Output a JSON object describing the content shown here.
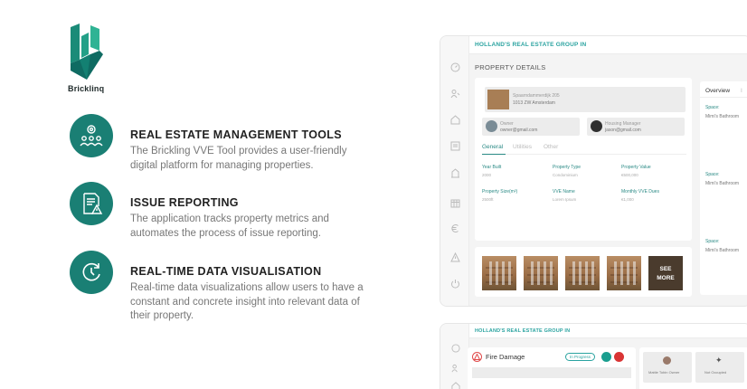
{
  "brand": {
    "name": "Bricklinq",
    "color": "#1a7f74"
  },
  "features": [
    {
      "icon": "team-gear-icon",
      "title": "REAL ESTATE MANAGEMENT TOOLS",
      "desc": "The Brickling VVE Tool provides a user-friendly digital platform for managing properties."
    },
    {
      "icon": "report-warning-icon",
      "title": "ISSUE REPORTING",
      "desc": "The application tracks property metrics and automates the process of issue reporting."
    },
    {
      "icon": "clock-refresh-icon",
      "title": "REAL-TIME DATA VISUALISATION",
      "desc": "Real-time data visualizations allow users to have a constant and concrete insight into relevant data of their property."
    }
  ],
  "mock1": {
    "org": "HOLLAND'S REAL ESTATE GROUP IN",
    "page_title": "PROPERTY DETAILS",
    "address_line1": "Spaarndammerdijk 205",
    "address_line2": "1013 ZW Amsterdam",
    "owner_label": "Owner",
    "owner_email": "owner@gmail.com",
    "manager_label": "Housing Manager",
    "manager_email": "jason@gmail.com",
    "tabs": [
      "General",
      "Utilities",
      "Other"
    ],
    "fields": [
      {
        "label": "Year Built",
        "value": "2000"
      },
      {
        "label": "Property Type",
        "value": "Condominium"
      },
      {
        "label": "Property Value",
        "value": "€500,000"
      },
      {
        "label": "Property Size(m²)",
        "value": "2500ft"
      },
      {
        "label": "VVE Name",
        "value": "Lorem Ipsum"
      },
      {
        "label": "Monthly VVE Dues",
        "value": "€1,000"
      }
    ],
    "see_more_line1": "SEE",
    "see_more_line2": "MORE",
    "right_tabs": [
      "Overview",
      "I"
    ],
    "spaces": [
      {
        "label": "Space:",
        "value": "Mimi's Bathroom"
      },
      {
        "label": "Space:",
        "value": "Mimi's Bathroom"
      },
      {
        "label": "Space:",
        "value": "Mimi's Bathroom"
      }
    ]
  },
  "mock2": {
    "org": "HOLLAND'S REAL ESTATE GROUP IN",
    "issue_title": "Fire Damage",
    "status": "In Progress",
    "card1": "Mattie Tobin Owner",
    "card2": "Not Occupied"
  }
}
